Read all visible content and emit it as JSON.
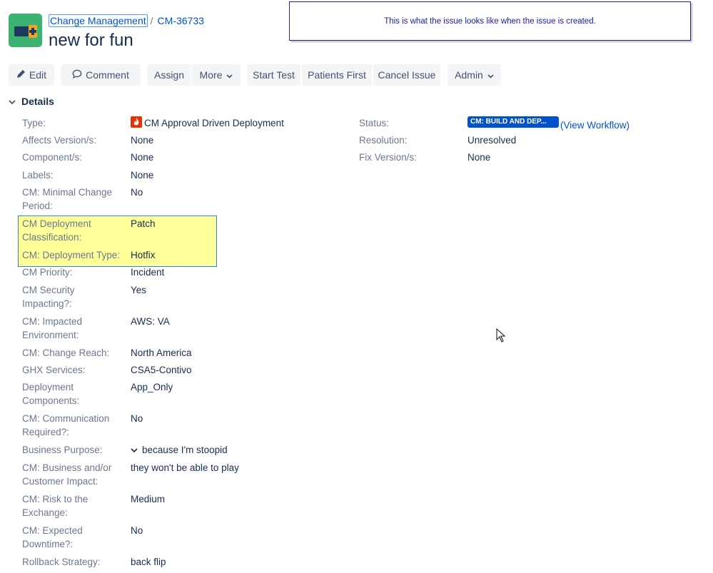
{
  "breadcrumb": {
    "project": "Change Management",
    "separator": "/",
    "issue_key": "CM-36733"
  },
  "issue": {
    "title": "new for fun"
  },
  "annotation": "This is what the issue looks like when the issue is created.",
  "toolbar": {
    "edit": "Edit",
    "comment": "Comment",
    "assign": "Assign",
    "more": "More",
    "start_test": "Start Test",
    "patients_first": "Patients First",
    "cancel_issue": "Cancel Issue",
    "admin": "Admin"
  },
  "details": {
    "heading": "Details",
    "fields": [
      {
        "label": "Type:",
        "value": "CM Approval Driven Deployment"
      },
      {
        "label": "Affects Version/s:",
        "value": "None"
      },
      {
        "label": "Component/s:",
        "value": "None"
      },
      {
        "label": "Labels:",
        "value": "None"
      },
      {
        "label": "CM: Minimal Change Period:",
        "value": "No"
      },
      {
        "label": "CM Deployment Classification:",
        "value": "Patch"
      },
      {
        "label": "CM: Deployment Type:",
        "value": "Hotfix"
      },
      {
        "label": "CM Priority:",
        "value": "Incident"
      },
      {
        "label": "CM Security Impacting?:",
        "value": "Yes"
      },
      {
        "label": "CM: Impacted Environment:",
        "value": "AWS: VA"
      },
      {
        "label": "CM: Change Reach:",
        "value": "North America"
      },
      {
        "label": "GHX Services:",
        "value": "CSA5-Contivo"
      },
      {
        "label": "Deployment Components:",
        "value": "App_Only"
      },
      {
        "label": "CM: Communication Required?:",
        "value": "No"
      },
      {
        "label": "Business Purpose:",
        "value": "because I'm stoopid"
      },
      {
        "label": "CM: Business and/or Customer Impact:",
        "value": "they won't be able to play"
      },
      {
        "label": "CM: Risk to the Exchange:",
        "value": "Medium"
      },
      {
        "label": "CM: Expected Downtime?:",
        "value": "No"
      },
      {
        "label": "Rollback Strategy:",
        "value": "back flip"
      }
    ],
    "right": {
      "status_label": "Status:",
      "status_value": "CM: BUILD AND DEP...",
      "view_workflow": "(View Workflow)",
      "resolution_label": "Resolution:",
      "resolution_value": "Unresolved",
      "fix_label": "Fix Version/s:",
      "fix_value": "None"
    }
  },
  "colors": {
    "link": "#0052cc",
    "status": "#0052cc",
    "highlight": "#ffff99",
    "avatar": "#3cb371",
    "type_icon": "#de350b"
  }
}
